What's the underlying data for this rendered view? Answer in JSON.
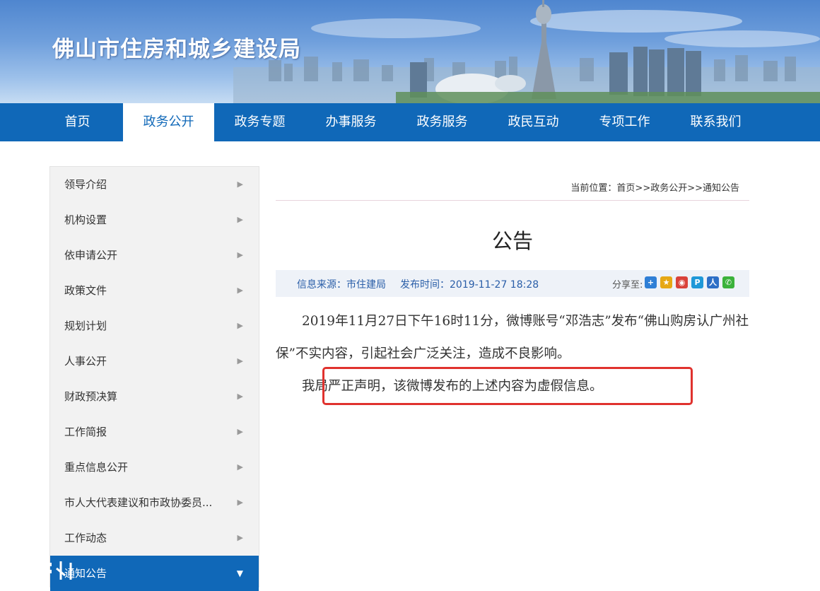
{
  "banner": {
    "title": "佛山市住房和城乡建设局"
  },
  "nav": {
    "items": [
      {
        "label": "首页",
        "active": false
      },
      {
        "label": "政务公开",
        "active": true
      },
      {
        "label": "政务专题",
        "active": false
      },
      {
        "label": "办事服务",
        "active": false
      },
      {
        "label": "政务服务",
        "active": false
      },
      {
        "label": "政民互动",
        "active": false
      },
      {
        "label": "专项工作",
        "active": false
      },
      {
        "label": "联系我们",
        "active": false
      }
    ]
  },
  "sidebar": {
    "items": [
      {
        "label": "领导介绍"
      },
      {
        "label": "机构设置"
      },
      {
        "label": "依申请公开"
      },
      {
        "label": "政策文件"
      },
      {
        "label": "规划计划"
      },
      {
        "label": "人事公开"
      },
      {
        "label": "财政预决算"
      },
      {
        "label": "工作简报"
      },
      {
        "label": "重点信息公开"
      },
      {
        "label": "市人大代表建议和市政协委员..."
      },
      {
        "label": "工作动态"
      },
      {
        "label": "通知公告",
        "active": true
      }
    ]
  },
  "breadcrumb": {
    "text": "当前位置：首页>>政务公开>>通知公告"
  },
  "article": {
    "title": "公告",
    "source": "信息来源：市住建局",
    "time": "发布时间：2019-11-27 18:28",
    "share_label": "分享至:",
    "share_icons": [
      {
        "name": "add-share-icon",
        "glyph": "+",
        "color": "#2f7fd6"
      },
      {
        "name": "qzone-icon",
        "glyph": "★",
        "color": "#e6a814"
      },
      {
        "name": "weibo-icon",
        "glyph": "◉",
        "color": "#d9423a"
      },
      {
        "name": "tencent-weibo-icon",
        "glyph": "P",
        "color": "#1f98d8"
      },
      {
        "name": "renren-icon",
        "glyph": "人",
        "color": "#2d6fc6"
      },
      {
        "name": "wechat-icon",
        "glyph": "✆",
        "color": "#3bb23b"
      }
    ],
    "paragraph1": "2019年11月27日下午16时11分，微博账号“邓浩志”发布“佛山购房认广州社保”不实内容，引起社会广泛关注，造成不良影响。",
    "paragraph2": "我局严正声明，该微博发布的上述内容为虚假信息。"
  },
  "colors": {
    "nav_blue": "#1068b8",
    "highlight_red": "#e0322e",
    "meta_text": "#2a5ea8"
  }
}
